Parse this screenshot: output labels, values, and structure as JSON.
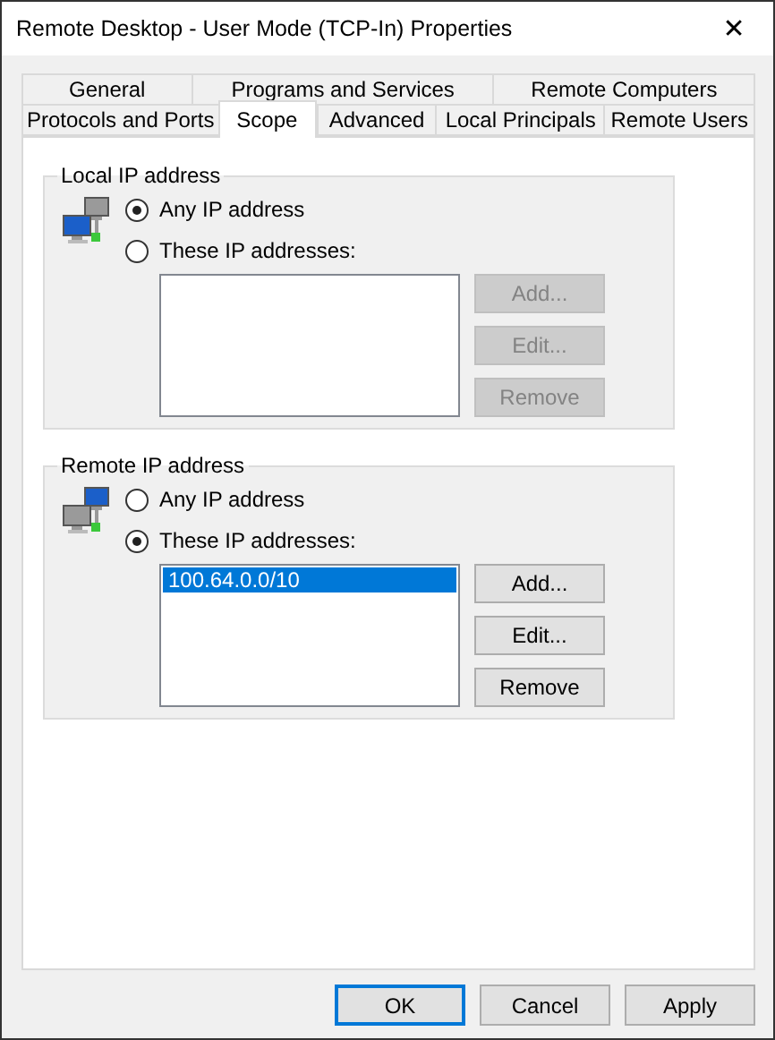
{
  "window": {
    "title": "Remote Desktop - User Mode (TCP-In) Properties",
    "close": "✕"
  },
  "tab_rows": [
    [
      {
        "label": "General",
        "selected": false
      },
      {
        "label": "Programs and Services",
        "selected": false
      },
      {
        "label": "Remote Computers",
        "selected": false
      }
    ],
    [
      {
        "label": "Protocols and Ports",
        "selected": false
      },
      {
        "label": "Scope",
        "selected": true
      },
      {
        "label": "Advanced",
        "selected": false
      },
      {
        "label": "Local Principals",
        "selected": false
      },
      {
        "label": "Remote Users",
        "selected": false
      }
    ]
  ],
  "groups": [
    {
      "title": "Local IP address",
      "options": [
        {
          "label": "Any IP address",
          "selected": true
        },
        {
          "label": "These IP addresses:",
          "selected": false
        }
      ],
      "buttons": [
        {
          "label": "Add...",
          "disabled": true
        },
        {
          "label": "Edit...",
          "disabled": true
        },
        {
          "label": "Remove",
          "disabled": true
        }
      ]
    },
    {
      "title": "Remote IP address",
      "options": [
        {
          "label": "Any IP address",
          "selected": false
        },
        {
          "label": "These IP addresses:",
          "selected": true
        }
      ],
      "list": [
        {
          "text": "100.64.0.0/10",
          "selected": true
        }
      ],
      "buttons": [
        {
          "label": "Add...",
          "disabled": false
        },
        {
          "label": "Edit...",
          "disabled": false
        },
        {
          "label": "Remove",
          "disabled": false
        }
      ]
    }
  ],
  "dialog_buttons": [
    {
      "label": "OK",
      "default": true
    },
    {
      "label": "Cancel",
      "default": false
    },
    {
      "label": "Apply",
      "default": false
    }
  ]
}
